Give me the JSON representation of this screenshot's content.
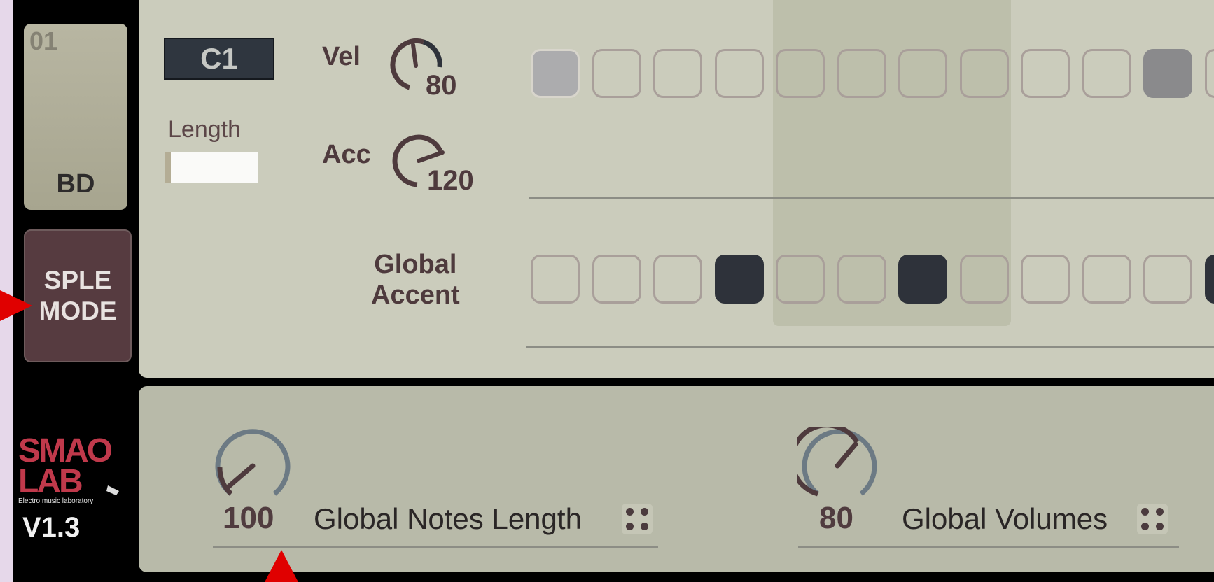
{
  "sidebar": {
    "track_number": "01",
    "track_name": "BD",
    "mode_button": "SPLE\nMODE",
    "logo_text": [
      "SMAO",
      "LAB"
    ],
    "logo_tagline": "Electro music laboratory",
    "version": "V1.3"
  },
  "track": {
    "note": "C1",
    "length_label": "Length",
    "velocity_label": "Vel",
    "velocity_value": "80",
    "accent_label": "Acc",
    "accent_value": "120",
    "global_accent_label": "Global\nAccent"
  },
  "velocity_steps": [
    1,
    0,
    0,
    0,
    0,
    0,
    0,
    0,
    0,
    0,
    2,
    0
  ],
  "accent_steps": [
    0,
    0,
    0,
    1,
    0,
    0,
    1,
    0,
    0,
    0,
    0,
    1
  ],
  "global": {
    "notes_length_value": "100",
    "notes_length_label": "Global Notes Length",
    "volumes_value": "80",
    "volumes_label": "Global Volumes"
  },
  "colors": {
    "accent_red": "#c0394b",
    "panel": "#cbccbc",
    "step_on_dark": "#2e323a"
  }
}
